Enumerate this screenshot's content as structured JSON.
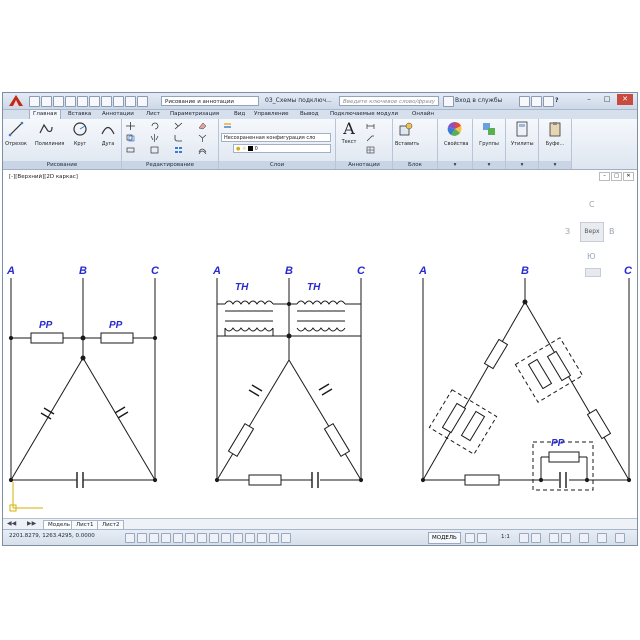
{
  "titlebar": {
    "workspace": "Рисование и аннотации",
    "document": "03_Схемы подключ...",
    "search_placeholder": "Введите ключевое слово/фразу",
    "signin": "Вход в службы",
    "help": "?"
  },
  "tabs": [
    "Главная",
    "Вставка",
    "Аннотации",
    "Лист",
    "Параметризация",
    "Вид",
    "Управление",
    "Вывод",
    "Подключаемые модули",
    "Онлайн"
  ],
  "ribbon": {
    "draw_tools": [
      "Отрезок",
      "Полилиния",
      "Круг",
      "Дуга"
    ],
    "layer_combo": "Несохраненная конфигурация сло",
    "layer_name": "0",
    "text_tool": "Текст",
    "insert_tool": "Вставить",
    "props_tool": "Свойства",
    "groups_tool": "Группы",
    "utils_tool": "Утилиты",
    "buffer_tool": "Буфе...",
    "panels": [
      "Рисование",
      "Редактирование",
      "Слои",
      "Аннотации",
      "Блок"
    ]
  },
  "viewport": {
    "label": "[-][Верхний][2D каркас]",
    "navcube": {
      "north": "С",
      "south": "Ю",
      "west": "З",
      "east": "В",
      "face": "Верх"
    }
  },
  "drawing": {
    "phases": [
      "A",
      "B",
      "C"
    ],
    "labels": {
      "relay": "РР",
      "transformer": "ТН"
    }
  },
  "layout_tabs": [
    "Модель",
    "Лист1",
    "Лист2"
  ],
  "status": {
    "coords": "2201.8279, 1263.4295, 0.0000",
    "model": "МОДЕЛЬ",
    "scale": "1:1"
  },
  "colors": {
    "phase_label": "#2a2ad0",
    "wire": "#1a1a1a",
    "accent": "#c0291a"
  }
}
